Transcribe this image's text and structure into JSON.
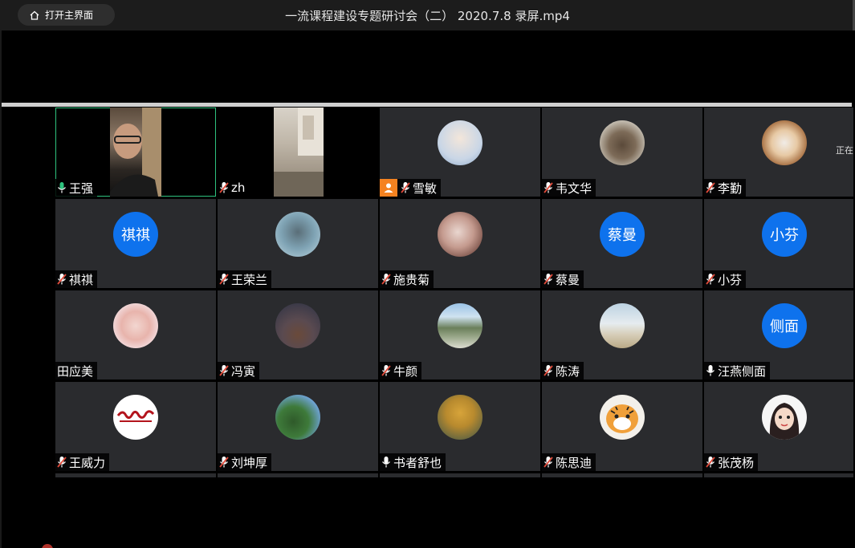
{
  "titlebar": {
    "home_label": "打开主界面",
    "window_title": "一流课程建设专题研讨会（二） 2020.7.8 录屏.mp4"
  },
  "side_tip": "正在",
  "participants": [
    {
      "name": "王强",
      "mic": "on"
    },
    {
      "name": "zh",
      "mic": "muted"
    },
    {
      "name": "雪敏",
      "mic": "muted",
      "badge": "person"
    },
    {
      "name": "韦文华",
      "mic": "muted"
    },
    {
      "name": "李勤",
      "mic": "muted"
    },
    {
      "name": "祺祺",
      "mic": "muted",
      "avatar_text": "祺祺"
    },
    {
      "name": "王荣兰",
      "mic": "muted"
    },
    {
      "name": "施贵菊",
      "mic": "muted"
    },
    {
      "name": "蔡曼",
      "mic": "muted",
      "avatar_text": "蔡曼"
    },
    {
      "name": "小芬",
      "mic": "muted",
      "avatar_text": "小芬"
    },
    {
      "name": "田应美",
      "mic": "none"
    },
    {
      "name": "冯寅",
      "mic": "muted"
    },
    {
      "name": "牛颜",
      "mic": "muted"
    },
    {
      "name": "陈涛",
      "mic": "muted"
    },
    {
      "name": "汪燕侧面",
      "mic": "on",
      "avatar_text": "侧面"
    },
    {
      "name": "王威力",
      "mic": "muted"
    },
    {
      "name": "刘坤厚",
      "mic": "muted"
    },
    {
      "name": "书者舒也",
      "mic": "on"
    },
    {
      "name": "陈思迪",
      "mic": "muted"
    },
    {
      "name": "张茂杨",
      "mic": "muted"
    }
  ],
  "colors": {
    "tile_bg": "#2a2b2e",
    "avatar_blue": "#0e72ed",
    "active_border": "#2ec27e",
    "mic_muted": "#e04a3a",
    "mic_on": "#2ec27e",
    "badge_orange": "#f58220"
  }
}
